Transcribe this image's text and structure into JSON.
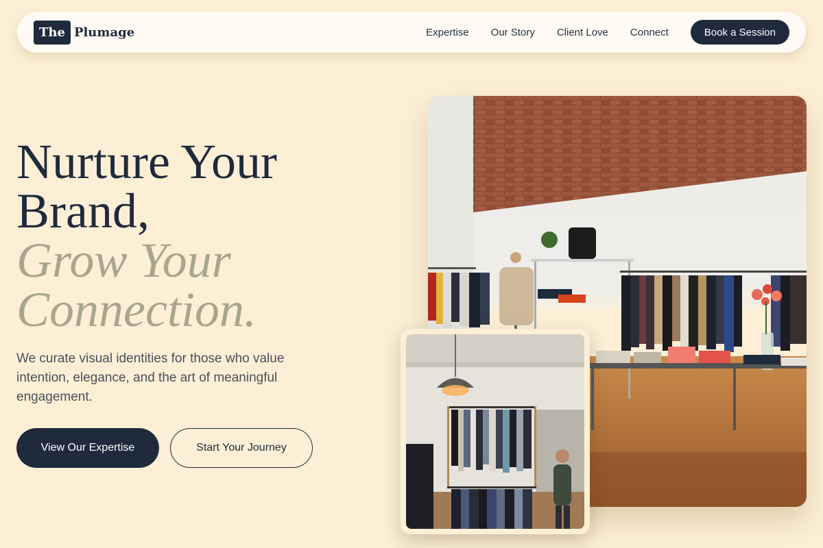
{
  "brand": {
    "logo_mark": "The",
    "logo_word": "Plumage"
  },
  "nav": {
    "items": [
      {
        "label": "Expertise"
      },
      {
        "label": "Our Story"
      },
      {
        "label": "Client Love"
      },
      {
        "label": "Connect"
      }
    ],
    "cta_label": "Book a Session"
  },
  "hero": {
    "title_line1": "Nurture Your",
    "title_line2": "Brand,",
    "title_line3": "Grow Your",
    "title_line4": "Connection.",
    "subtitle": "We curate visual identities for those who value intention, elegance, and the art of meaningful engagement.",
    "primary_cta": "View Our Expertise",
    "secondary_cta": "Start Your Journey"
  },
  "images": {
    "main_alt": "boutique-store-interior",
    "secondary_alt": "clothing-rack-with-pendant-lamp"
  },
  "colors": {
    "background": "#fcefd5",
    "navy": "#1f2a3d",
    "accent_sage": "#a8a68d",
    "nav_bg": "#fffaf3"
  }
}
